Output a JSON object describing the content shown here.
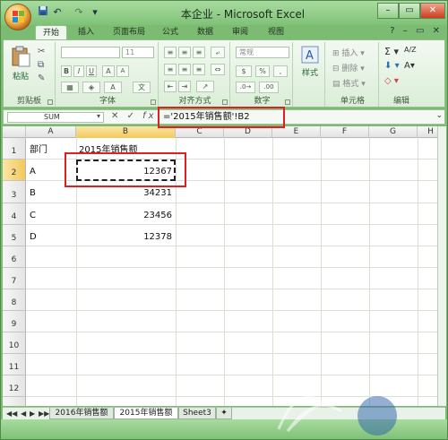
{
  "window": {
    "title": "本企业 - Microsoft Excel",
    "qat": [
      "↶",
      "↷",
      "▾"
    ],
    "controls": {
      "minimize": "–",
      "maximize": "▭",
      "close": "✕"
    }
  },
  "ribbon": {
    "tabs": [
      "开始",
      "插入",
      "页面布局",
      "公式",
      "数据",
      "审阅",
      "视图"
    ],
    "active_tab": "开始",
    "right_icons": [
      "?",
      "–",
      "▭",
      "✕"
    ],
    "groups": {
      "clipboard": {
        "label": "剪贴板",
        "paste": "粘贴"
      },
      "font": {
        "label": "字体",
        "font_size": "11",
        "bold": "B",
        "italic": "I",
        "underline": "U",
        "grow": "A",
        "shrink": "A"
      },
      "alignment": {
        "label": "对齐方式"
      },
      "number": {
        "label": "数字",
        "format": "常规",
        "percent": "%",
        "comma": ",",
        "currency": "$"
      },
      "styles": {
        "label": "样式"
      },
      "cells": {
        "label": "单元格",
        "insert": "插入",
        "delete": "删除",
        "format": "格式"
      },
      "editing": {
        "label": "编辑",
        "sum": "Σ",
        "sort": "A/Z",
        "find": "A"
      }
    }
  },
  "formula_bar": {
    "name_box": "SUM",
    "icons": [
      "✕",
      "✓",
      "fx"
    ],
    "formula": "='2015年销售额'!B2"
  },
  "sheet": {
    "columns": [
      "A",
      "B",
      "C",
      "D",
      "E",
      "F",
      "G",
      "H"
    ],
    "selected_column": "B",
    "rows": [
      "1",
      "2",
      "3",
      "4",
      "5",
      "6",
      "7",
      "8",
      "9",
      "10",
      "11",
      "12",
      "13",
      "14"
    ],
    "selected_row": "2",
    "cells": {
      "A1": "部门",
      "B1": "2015年销售额",
      "A2": "A",
      "B2": "12367",
      "A3": "B",
      "B3": "34231",
      "A4": "C",
      "B4": "23456",
      "A5": "D",
      "B5": "12378"
    }
  },
  "sheet_tabs": {
    "nav": [
      "◀◀",
      "◀",
      "▶",
      "▶▶"
    ],
    "tabs": [
      "2016年销售额",
      "2015年销售额",
      "Sheet3"
    ],
    "active": "2015年销售额"
  },
  "colors": {
    "highlight": "#e02020",
    "titlebar": "#7fc277",
    "ribbon": "#eef6ee"
  }
}
